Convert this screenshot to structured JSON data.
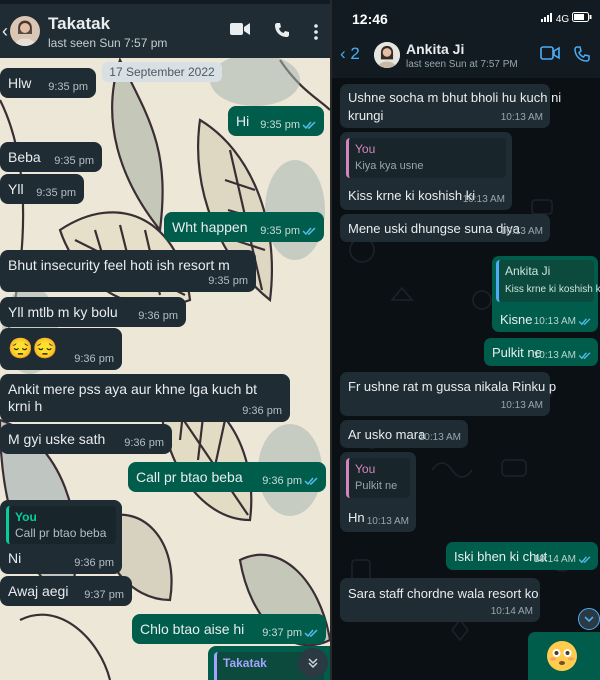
{
  "left_chat": {
    "contact_name": "Takatak",
    "last_seen": "last seen Sun 7:57 pm",
    "date_label": "17 September 2022",
    "messages": [
      {
        "text": "Hlw",
        "time": "9:35 pm",
        "dir": "in"
      },
      {
        "text": "Hi",
        "time": "9:35 pm",
        "dir": "out"
      },
      {
        "text": "Beba",
        "time": "9:35 pm",
        "dir": "in"
      },
      {
        "text": "Yll",
        "time": "9:35 pm",
        "dir": "in"
      },
      {
        "text": "Wht happen",
        "time": "9:35 pm",
        "dir": "out"
      },
      {
        "text": "Bhut insecurity feel hoti ish resort m",
        "time": "9:35 pm",
        "dir": "in"
      },
      {
        "text": "Yll mtlb m ky bolu",
        "time": "9:36 pm",
        "dir": "in"
      },
      {
        "text": "😔😔",
        "time": "9:36 pm",
        "dir": "in"
      },
      {
        "text_line1": "Ankit mere pss aya aur khne lga kuch bt",
        "text_line2": "krni h",
        "time": "9:36 pm",
        "dir": "in"
      },
      {
        "text": "M gyi uske sath",
        "time": "9:36 pm",
        "dir": "in"
      },
      {
        "text": "Call pr btao beba",
        "time": "9:36 pm",
        "dir": "out"
      },
      {
        "quote_name": "You",
        "quote_text": "Call pr btao beba",
        "text": "Ni",
        "time": "9:36 pm",
        "dir": "in"
      },
      {
        "text": "Awaj aegi",
        "time": "9:37 pm",
        "dir": "in"
      },
      {
        "text": "Chlo btao aise hi",
        "time": "9:37 pm",
        "dir": "out"
      },
      {
        "quote_name": "Takatak",
        "dir": "out"
      }
    ]
  },
  "right_chat": {
    "status_time": "12:46",
    "network": "4G",
    "back_count": "2",
    "contact_name": "Ankita Ji",
    "last_seen": "last seen Sun at 7:57 PM",
    "messages": [
      {
        "text_line1": "Ushne socha m bhut bholi hu kuch ni",
        "text_line2": "krungi",
        "time": "10:13 AM",
        "dir": "in"
      },
      {
        "quote_name": "You",
        "quote_text": "Kiya kya usne",
        "text": "Kiss krne ki koshish ki",
        "time": "10:13 AM",
        "dir": "in"
      },
      {
        "text": "Mene uski dhungse suna diya",
        "time": "10:13 AM",
        "dir": "in"
      },
      {
        "quote_name": "Ankita Ji",
        "quote_text": "Kiss krne ki koshish ki",
        "text": "Kisne",
        "time": "10:13 AM",
        "dir": "out"
      },
      {
        "text": "Pulkit ne",
        "time": "10:13 AM",
        "dir": "out"
      },
      {
        "text": "Fr ushne rat m gussa nikala Rinku p",
        "time": "10:13 AM",
        "dir": "in"
      },
      {
        "text": "Ar usko mara",
        "time": "10:13 AM",
        "dir": "in"
      },
      {
        "quote_name": "You",
        "quote_text": "Pulkit ne",
        "text": "Hn",
        "time": "10:13 AM",
        "dir": "in"
      },
      {
        "text": "Iski bhen ki chut",
        "time": "10:14 AM",
        "dir": "out"
      },
      {
        "text": "Sara staff chordne wala resort ko",
        "time": "10:14 AM",
        "dir": "in"
      }
    ]
  },
  "colors": {
    "accent_green": "#005c4b",
    "incoming_bubble": "#1f2c33",
    "read_tick_blue": "#53bdeb",
    "ios_blue": "#4cadf5"
  },
  "icons": [
    "back-arrow-icon",
    "video-call-icon",
    "voice-call-icon",
    "more-menu-icon",
    "read-receipt-icon",
    "scroll-down-icon",
    "signal-icon",
    "battery-icon"
  ]
}
